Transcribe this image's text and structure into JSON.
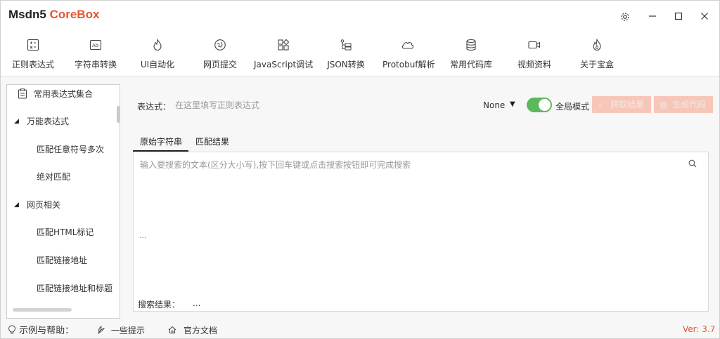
{
  "window": {
    "title_main": "Msdn5 ",
    "title_brand": "CoreBox",
    "brand_color": "#e8542f"
  },
  "toolbar": {
    "items": [
      {
        "label": "正则表达式",
        "icon": "regex-icon"
      },
      {
        "label": "字符串转换",
        "icon": "text-convert-icon"
      },
      {
        "label": "UI自动化",
        "icon": "flame-icon"
      },
      {
        "label": "网页提交",
        "icon": "globe-icon"
      },
      {
        "label": "JavaScript调试",
        "icon": "grid-icon"
      },
      {
        "label": "JSON转换",
        "icon": "tree-structure-icon"
      },
      {
        "label": "Protobuf解析",
        "icon": "cloud-icon"
      },
      {
        "label": "常用代码库",
        "icon": "database-icon"
      },
      {
        "label": "视频资料",
        "icon": "video-icon"
      },
      {
        "label": "关于宝盒",
        "icon": "flame-outline-icon"
      }
    ]
  },
  "tree": {
    "root": "常用表达式集合",
    "group1": "万能表达式",
    "g1_item1": "匹配任意符号多次",
    "g1_item2": "绝对匹配",
    "group2": "网页相关",
    "g2_item1": "匹配HTML标记",
    "g2_item2": "匹配链接地址",
    "g2_item3": "匹配链接地址和标题"
  },
  "expression": {
    "label": "表达式：",
    "placeholder": "在这里填写正则表达式",
    "mode": "None",
    "global_label": "全局模式",
    "global_on": true,
    "toggle_color": "#5cb85c",
    "get_result": "获取结果",
    "generate_code": "生成代码"
  },
  "tabs": {
    "original": "原始字符串",
    "match": "匹配结果"
  },
  "content": {
    "search_placeholder": "输入要搜索的文本(区分大小写),按下回车键或点击搜索按钮即可完成搜索",
    "ellipsis": "...",
    "result_label": "搜索结果：",
    "result_value": "..."
  },
  "footer": {
    "help_label": "示例与帮助：",
    "tips": "一些提示",
    "docs": "官方文档",
    "version": "Ver: 3.7"
  }
}
